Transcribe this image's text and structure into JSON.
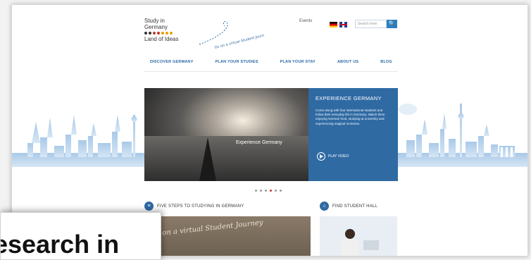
{
  "logo": {
    "line1": "Study in",
    "line2": "Germany",
    "line3": "Land of Ideas"
  },
  "tagline": "Go on a virtual Student Journey",
  "header": {
    "events_label": "Events",
    "search_placeholder": "Search here",
    "search_btn": "🔍"
  },
  "nav": [
    "DISCOVER GERMANY",
    "PLAN YOUR STUDIES",
    "PLAN YOUR STAY",
    "ABOUT US",
    "BLOG"
  ],
  "hero": {
    "image_caption": "Experience Germany",
    "panel_title": "EXPERIENCE GERMANY",
    "panel_body": "Come along with four international students and follow their everyday life in Germany. Watch them enjoying German food, studying at university and experiencing magical moments.",
    "play_label": "PLAY VIDEO"
  },
  "pager": {
    "count": 6,
    "active": 4
  },
  "sections": {
    "steps_title": "FIVE STEPS TO STUDYING IN GERMANY",
    "steps_image_text": "Go on a virtual Student Journey",
    "hall_title": "FIND STUDENT HALL"
  },
  "zoom_overlay": {
    "text": "esearch in"
  },
  "colors": {
    "brand_blue": "#2f6aa3",
    "skyline": "#9fc2e4"
  }
}
